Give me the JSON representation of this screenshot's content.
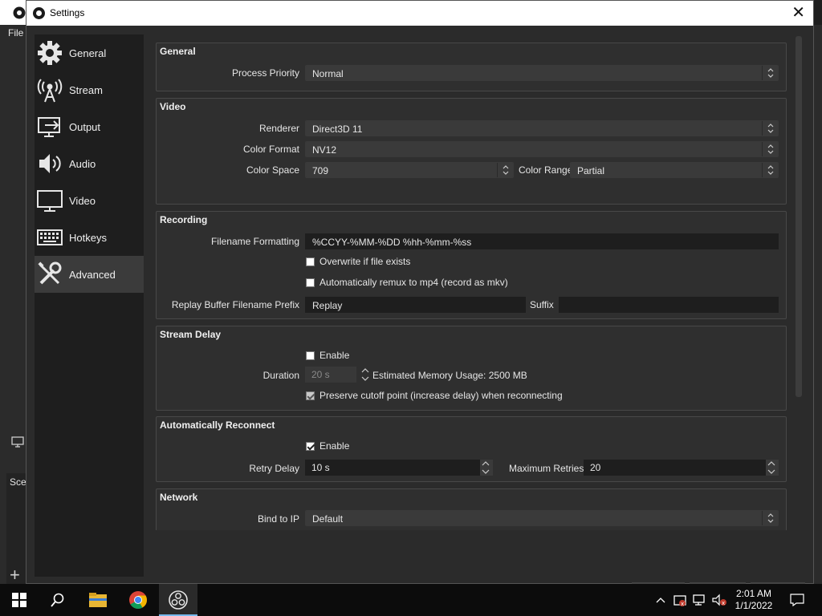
{
  "background_window": {
    "menu_file": "File",
    "scenes_label": "Scen"
  },
  "dialog": {
    "title": "Settings",
    "close_glyph": "✕"
  },
  "sidebar": {
    "items": [
      {
        "label": "General",
        "icon": "gear-icon"
      },
      {
        "label": "Stream",
        "icon": "broadcast-icon"
      },
      {
        "label": "Output",
        "icon": "output-icon"
      },
      {
        "label": "Audio",
        "icon": "speaker-icon"
      },
      {
        "label": "Video",
        "icon": "monitor-icon"
      },
      {
        "label": "Hotkeys",
        "icon": "keyboard-icon"
      },
      {
        "label": "Advanced",
        "icon": "tools-icon"
      }
    ],
    "active": "Advanced"
  },
  "general": {
    "title": "General",
    "process_priority_label": "Process Priority",
    "process_priority_value": "Normal"
  },
  "video": {
    "title": "Video",
    "renderer_label": "Renderer",
    "renderer_value": "Direct3D 11",
    "color_format_label": "Color Format",
    "color_format_value": "NV12",
    "color_space_label": "Color Space",
    "color_space_value": "709",
    "color_range_label": "Color Range",
    "color_range_value": "Partial"
  },
  "recording": {
    "title": "Recording",
    "filename_formatting_label": "Filename Formatting",
    "filename_formatting_value": "%CCYY-%MM-%DD %hh-%mm-%ss",
    "overwrite_label": "Overwrite if file exists",
    "overwrite_checked": false,
    "remux_label": "Automatically remux to mp4 (record as mkv)",
    "remux_checked": false,
    "replay_prefix_label": "Replay Buffer Filename Prefix",
    "replay_prefix_value": "Replay",
    "suffix_label": "Suffix",
    "suffix_value": ""
  },
  "stream_delay": {
    "title": "Stream Delay",
    "enable_label": "Enable",
    "enable_checked": false,
    "duration_label": "Duration",
    "duration_value": "20 s",
    "memory_usage": "Estimated Memory Usage: 2500 MB",
    "preserve_label": "Preserve cutoff point (increase delay) when reconnecting",
    "preserve_checked": true
  },
  "auto_reconnect": {
    "title": "Automatically Reconnect",
    "enable_label": "Enable",
    "enable_checked": true,
    "retry_delay_label": "Retry Delay",
    "retry_delay_value": "10 s",
    "max_retries_label": "Maximum Retries",
    "max_retries_value": "20"
  },
  "network": {
    "title": "Network",
    "bind_ip_label": "Bind to IP",
    "bind_ip_value": "Default"
  },
  "taskbar": {
    "time": "2:01 AM",
    "date": "1/1/2022"
  }
}
